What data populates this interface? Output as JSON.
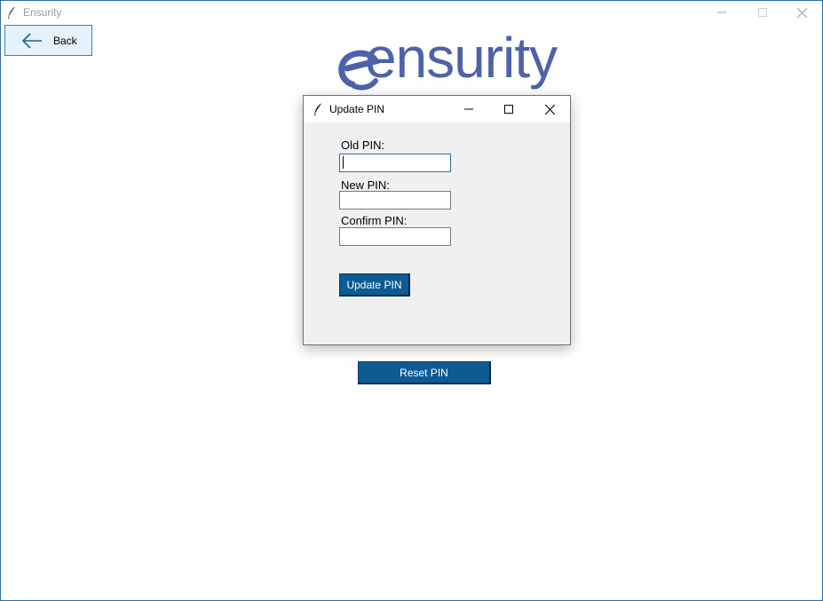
{
  "window": {
    "title": "Ensurity"
  },
  "back_button": {
    "label": "Back"
  },
  "logo": {
    "text": "ensurity"
  },
  "reset_button": {
    "label": "Reset PIN"
  },
  "dialog": {
    "title": "Update PIN",
    "fields": [
      {
        "label": "Old PIN:",
        "value": "",
        "placeholder": ""
      },
      {
        "label": "New PIN:",
        "value": "",
        "placeholder": ""
      },
      {
        "label": "Confirm PIN:",
        "value": "",
        "placeholder": ""
      }
    ],
    "update_button": "Update PIN"
  },
  "colors": {
    "accent": "#0d5b92",
    "logo": "#4d62a8",
    "window_border": "#2b6ea8",
    "back_bg": "#e5f1fb"
  },
  "icons": {
    "app": "feather-icon",
    "back": "arrow-left-icon",
    "minimize": "minimize-icon",
    "maximize": "maximize-icon",
    "close": "close-icon"
  }
}
